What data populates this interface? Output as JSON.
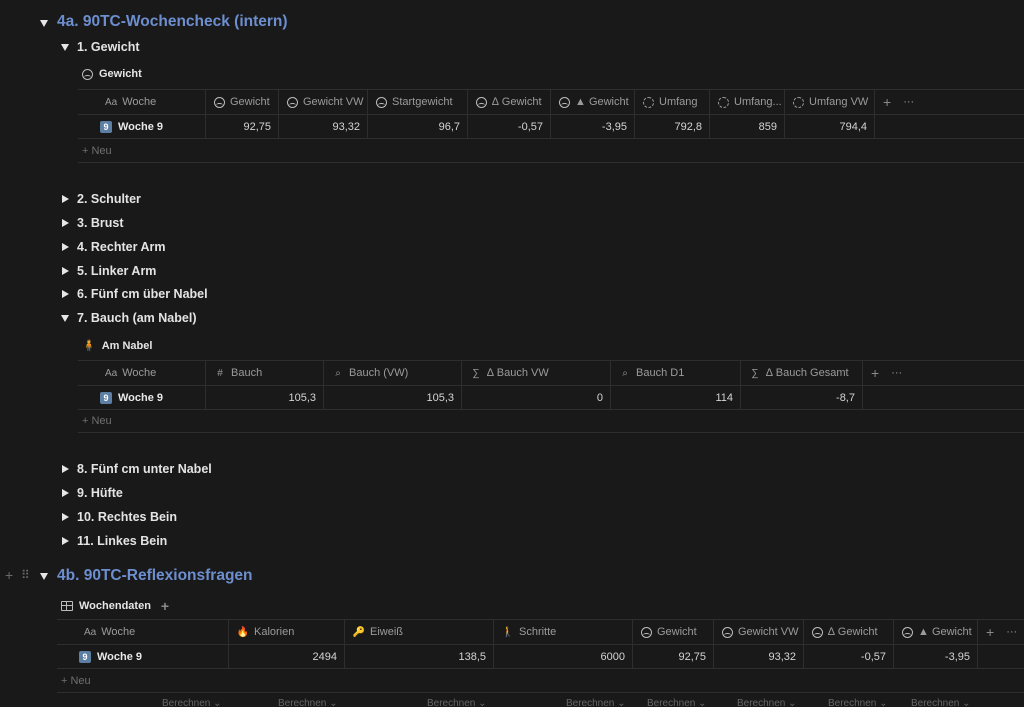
{
  "section_a": {
    "title": "4a. 90TC-Wochencheck (intern)",
    "toggle_1": "1. Gewicht",
    "view_1": "Gewicht",
    "table_1": {
      "headers": [
        "Woche",
        "Gewicht",
        "Gewicht VW",
        "Startgewicht",
        "∆ Gewicht",
        "▲ Gewicht",
        "Umfang",
        "Umfang...",
        "Umfang VW"
      ],
      "name_prefix": "Aa",
      "row": {
        "badge": "9",
        "name": "Woche 9",
        "values": [
          "92,75",
          "93,32",
          "96,7",
          "-0,57",
          "-3,95",
          "792,8",
          "859",
          "794,4"
        ]
      },
      "new_label": "Neu"
    },
    "toggles_mid": [
      "2. Schulter",
      "3. Brust",
      "4. Rechter Arm",
      "5. Linker Arm",
      "6. Fünf cm über Nabel"
    ],
    "toggle_7": "7. Bauch (am Nabel)",
    "view_7": "Am Nabel",
    "table_7": {
      "headers": [
        "Woche",
        "Bauch",
        "Bauch (VW)",
        "∆ Bauch VW",
        "Bauch D1",
        "∆ Bauch Gesamt"
      ],
      "name_prefix": "Aa",
      "row": {
        "badge": "9",
        "name": "Woche 9",
        "values": [
          "105,3",
          "105,3",
          "0",
          "114",
          "-8,7"
        ]
      },
      "new_label": "Neu"
    },
    "toggles_end": [
      "8. Fünf cm unter Nabel",
      "9. Hüfte",
      "10. Rechtes Bein",
      "11. Linkes Bein"
    ]
  },
  "section_b": {
    "title": "4b. 90TC-Reflexionsfragen",
    "view": "Wochendaten",
    "table": {
      "headers": [
        "Woche",
        "Kalorien",
        "Eiweiß",
        "Schritte",
        "Gewicht",
        "Gewicht VW",
        "∆ Gewicht",
        "▲ Gewicht"
      ],
      "name_prefix": "Aa",
      "row": {
        "badge": "9",
        "name": "Woche 9",
        "values": [
          "2494",
          "138,5",
          "6000",
          "92,75",
          "93,32",
          "-0,57",
          "-3,95"
        ]
      },
      "new_label": "Neu",
      "calc_label": "Berechnen ⌄"
    }
  },
  "icons": {
    "plus": "+",
    "more": "···",
    "drag": "⠿",
    "sigma": "∑",
    "hash": "#",
    "search": "⌕",
    "flame": "🔥",
    "key": "🔑",
    "walk": "🚶",
    "person": "🧍"
  },
  "colors": {
    "background": "#191919",
    "heading_blue": "#6d8ecf",
    "badge": "#5d7fa3"
  }
}
